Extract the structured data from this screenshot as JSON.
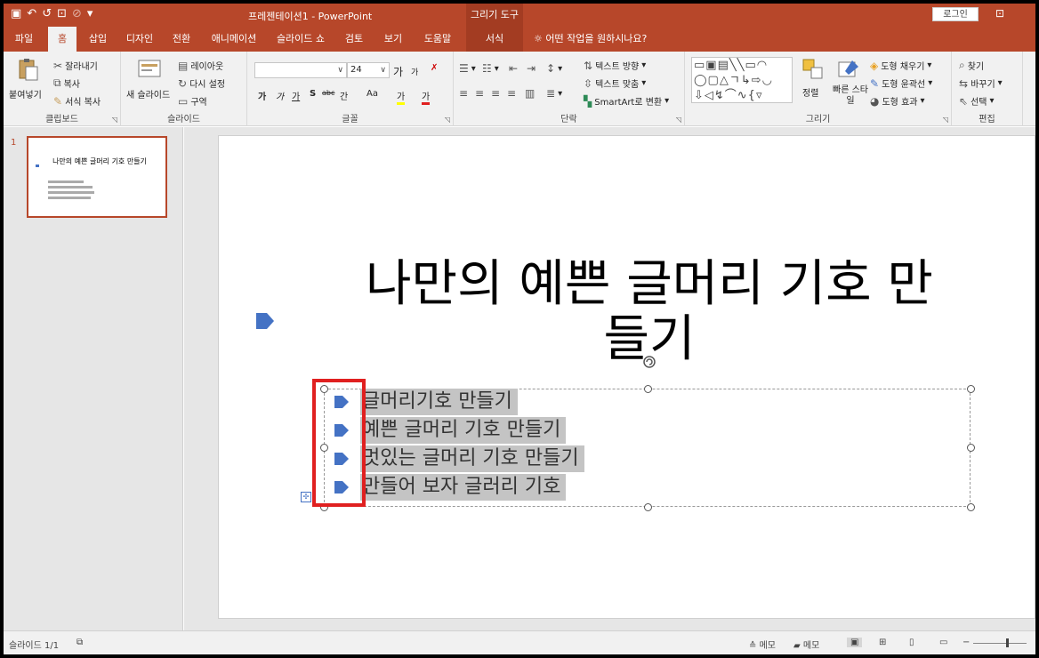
{
  "titlebar": {
    "doc_title": "프레젠테이션1  -  PowerPoint",
    "context_group": "그리기 도구",
    "login": "로그인",
    "save_glyph": "▣",
    "undo_glyph": "↶",
    "redo_glyph": "↺",
    "start_glyph": "⊡",
    "disabled_glyph": "⊘",
    "customize_glyph": "▾",
    "restore_glyph": "⊡"
  },
  "tabs": [
    {
      "label": "파일"
    },
    {
      "label": "홈"
    },
    {
      "label": "삽입"
    },
    {
      "label": "디자인"
    },
    {
      "label": "전환"
    },
    {
      "label": "애니메이션"
    },
    {
      "label": "슬라이드 쇼"
    },
    {
      "label": "검토"
    },
    {
      "label": "보기"
    },
    {
      "label": "도움말"
    },
    {
      "label": "서식"
    }
  ],
  "tellme": "어떤 작업을 원하시나요?",
  "ribbon": {
    "clipboard": {
      "label": "클립보드",
      "paste": "붙여넣기",
      "cut": "잘라내기",
      "copy": "복사",
      "format_painter": "서식 복사"
    },
    "slides": {
      "label": "슬라이드",
      "new_slide": "새 슬라이드",
      "layout": "레이아웃",
      "reset": "다시 설정",
      "section": "구역"
    },
    "font": {
      "label": "글꼴",
      "font_name": "",
      "font_size": "24",
      "grow": "가",
      "shrink": "가",
      "bold": "가",
      "italic": "가",
      "underline": "가",
      "shadow": "S",
      "strike": "abc",
      "spacing": "간",
      "case": "Aa",
      "highlight": "가",
      "color": "가"
    },
    "paragraph": {
      "label": "단락",
      "text_direction": "텍스트 방향",
      "align_text": "텍스트 맞춤",
      "smartart": "SmartArt로 변환"
    },
    "drawing": {
      "label": "그리기",
      "arrange": "정렬",
      "quick_styles": "빠른 스타일",
      "fill": "도형 채우기",
      "outline": "도형 윤곽선",
      "effects": "도형 효과"
    },
    "editing": {
      "label": "편집",
      "find": "찾기",
      "replace": "바꾸기",
      "select": "선택"
    }
  },
  "thumbnail": {
    "number": "1",
    "title": "나만의 예쁜 글머리 기호 만들기"
  },
  "slide": {
    "title": "나만의 예쁜 글머리 기호 만들기",
    "bullets": [
      "글머리기호 만들기",
      "예쁜 글머리 기호 만들기",
      "멋있는 글머리 기호 만들기",
      "만들어 보자 글러리 기호"
    ]
  },
  "statusbar": {
    "slide_info": "슬라이드 1/1",
    "notes": "메모",
    "comments": "메모"
  },
  "colors": {
    "accent": "#b7472a",
    "bullet": "#4472c4",
    "highlight": "#e02020"
  }
}
